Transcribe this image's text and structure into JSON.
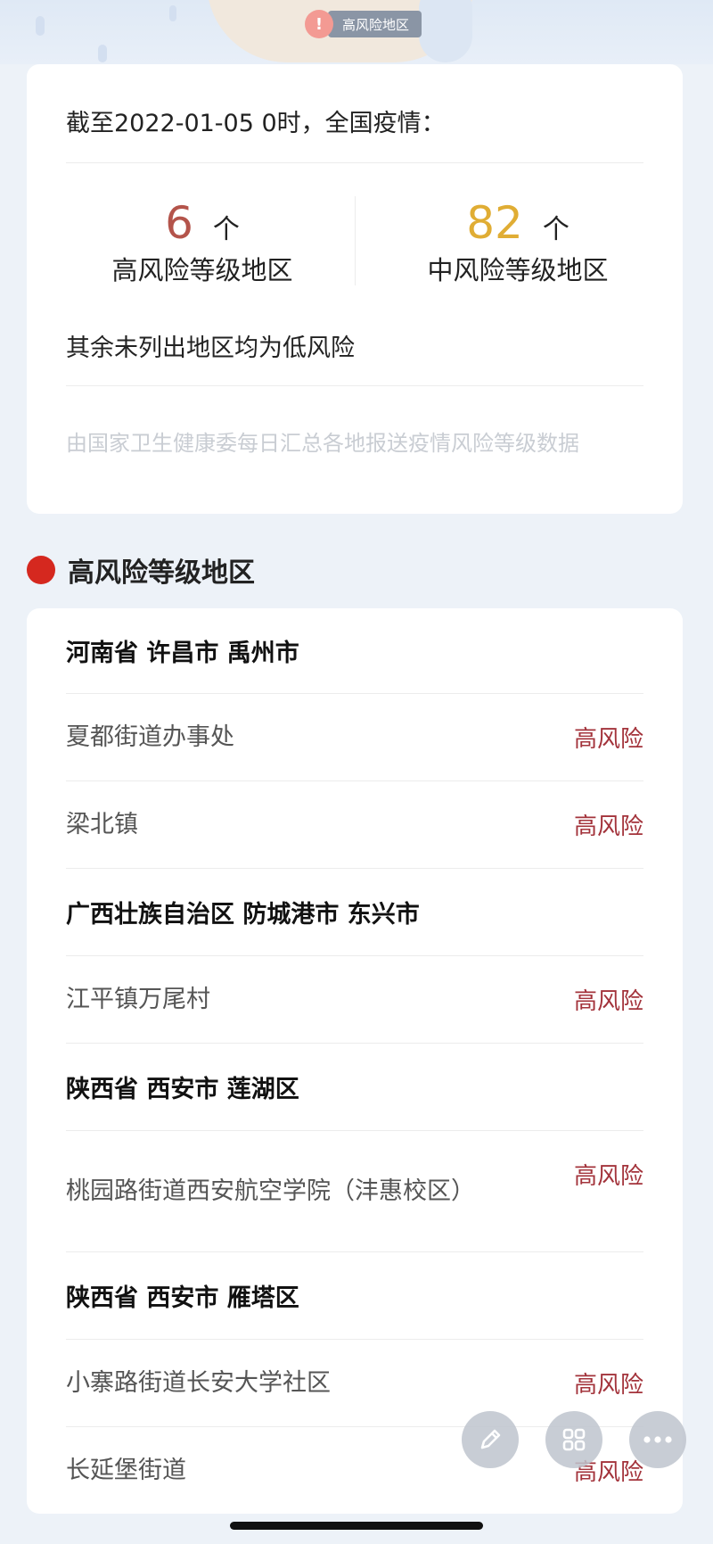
{
  "banner": {
    "chip_label": "高风险地区",
    "alert_glyph": "!"
  },
  "summary": {
    "as_of": "截至2022-01-05 0时，全国疫情：",
    "high": {
      "count": "6",
      "unit": "个",
      "caption": "高风险等级地区"
    },
    "medium": {
      "count": "82",
      "unit": "个",
      "caption": "中风险等级地区"
    },
    "rest_note": "其余未列出地区均为低风险",
    "source_note": "由国家卫生健康委每日汇总各地报送疫情风险等级数据"
  },
  "section": {
    "title": "高风险等级地区"
  },
  "list": {
    "regions": [
      {
        "name": "河南省 许昌市 禹州市",
        "places": [
          {
            "name": "夏都街道办事处",
            "level": "高风险"
          },
          {
            "name": "梁北镇",
            "level": "高风险"
          }
        ]
      },
      {
        "name": "广西壮族自治区 防城港市 东兴市",
        "places": [
          {
            "name": "江平镇万尾村",
            "level": "高风险"
          }
        ]
      },
      {
        "name": "陕西省 西安市 莲湖区",
        "places": [
          {
            "name": "桃园路街道西安航空学院（沣惠校区）",
            "level": "高风险"
          }
        ]
      },
      {
        "name": "陕西省 西安市 雁塔区",
        "places": [
          {
            "name": "小寨路街道长安大学社区",
            "level": "高风险"
          },
          {
            "name": "长延堡街道",
            "level": "高风险"
          }
        ]
      }
    ]
  },
  "fabs": [
    "edit-icon",
    "grid-icon",
    "more-icon"
  ],
  "colors": {
    "high": "#b4544b",
    "medium": "#e0ad34",
    "risk_text": "#a3333b",
    "section_dot": "#d5281f"
  }
}
